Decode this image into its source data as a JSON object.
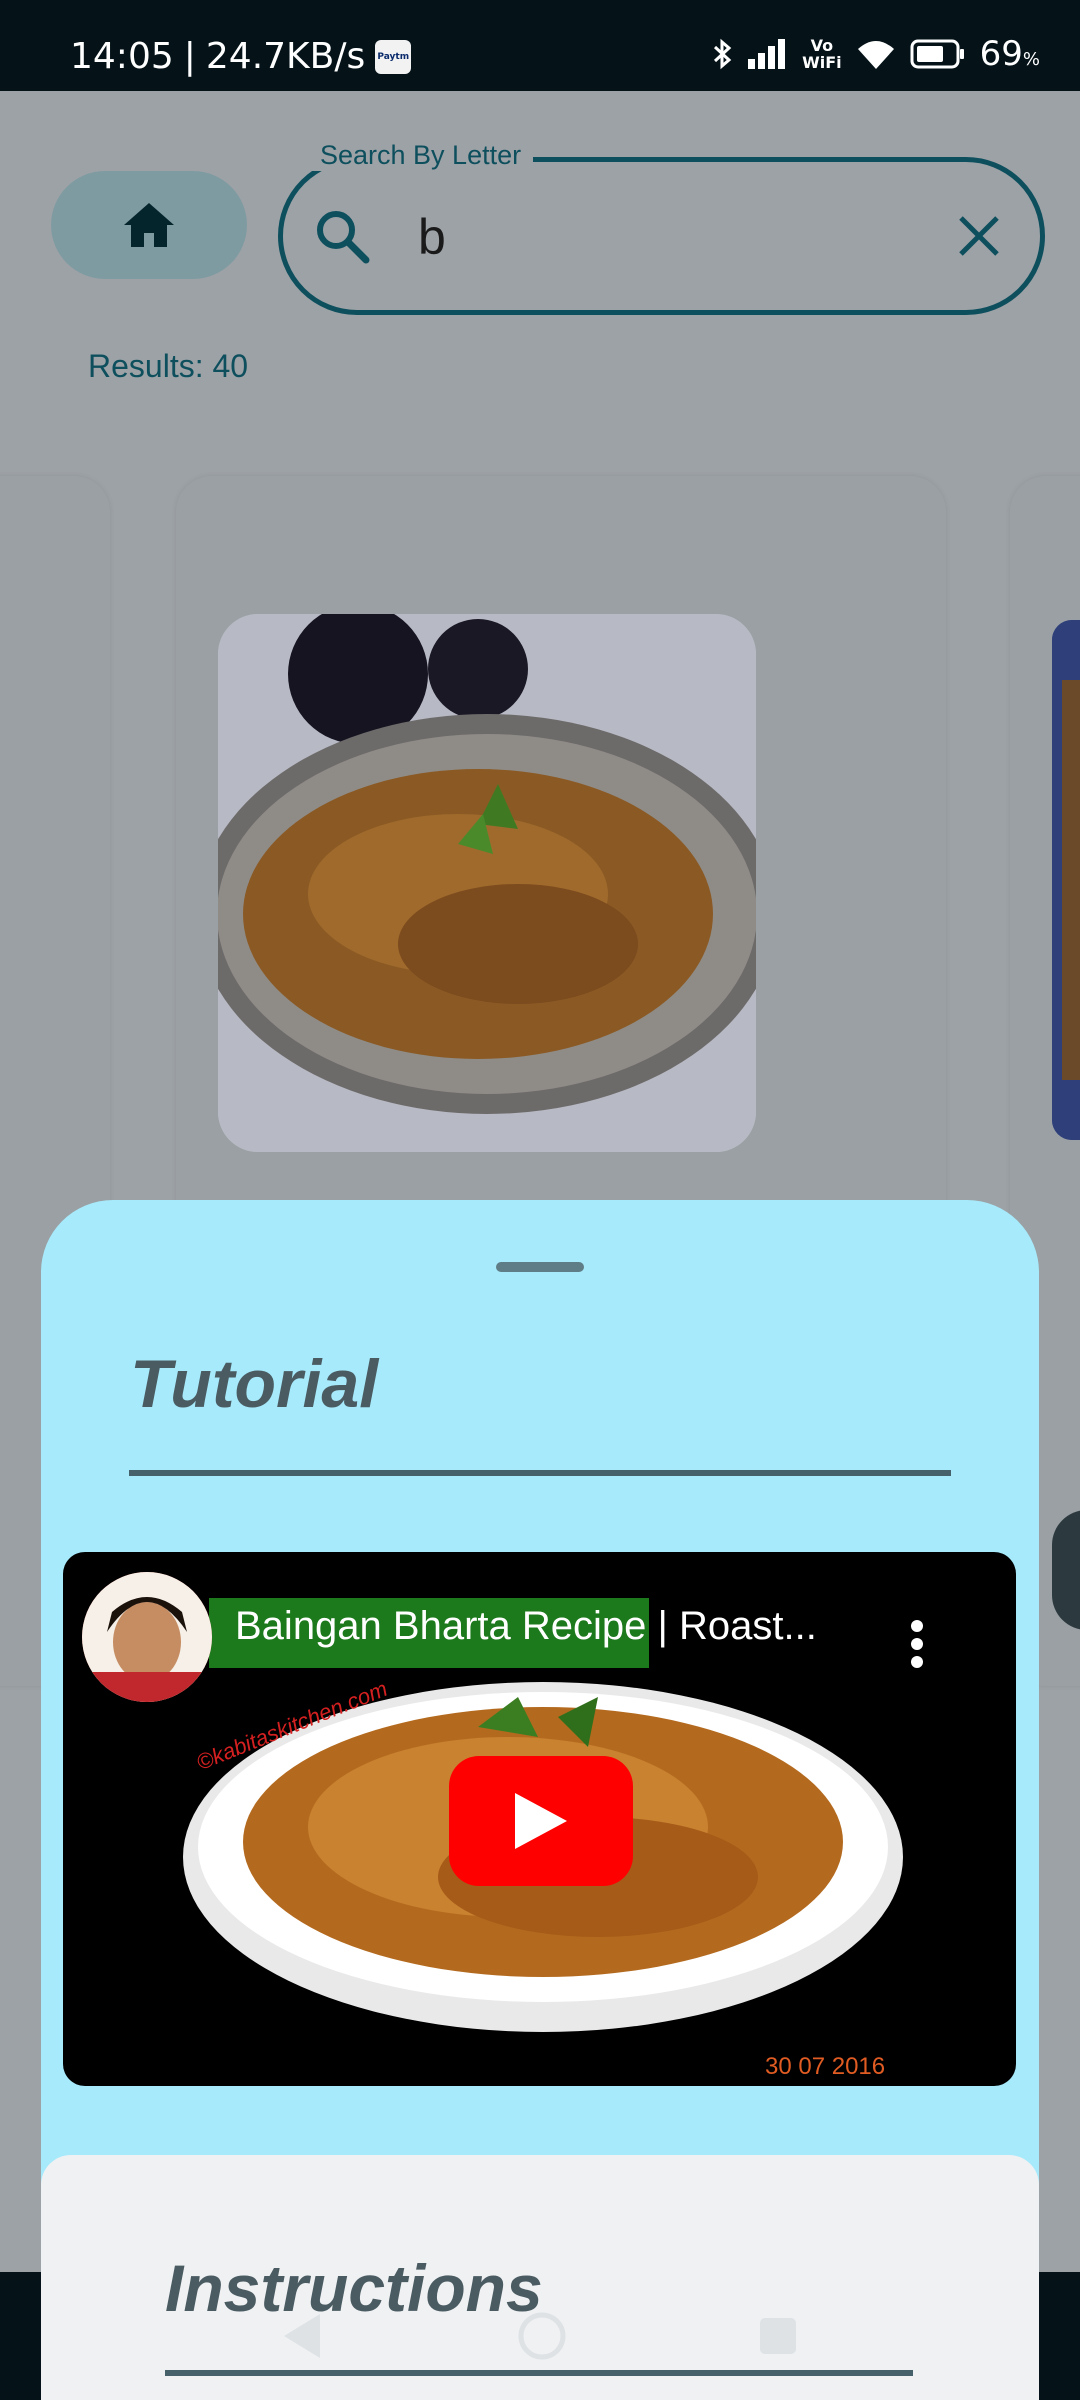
{
  "status_bar": {
    "time": "14:05",
    "separator": "|",
    "speed": "24.7KB/s",
    "paytm": "Paytm",
    "vowifi": [
      "Vo",
      "WiFi"
    ],
    "battery_level": "69",
    "battery_unit": "%"
  },
  "search": {
    "legend": "Search By Letter",
    "value": "b"
  },
  "results_label": "Results: 40",
  "tutorial": {
    "title": "Tutorial"
  },
  "video": {
    "title": "Baingan Bharta Recipe | Roast...",
    "watermark": "©kabitaskitchen.com",
    "date": "30 07 2016"
  },
  "instructions": {
    "title": "Instructions"
  },
  "colors": {
    "sheet_bg": "#a6eafb",
    "accent_teal": "#0e4f5e",
    "youtube_red": "#ff0000",
    "heading_gray": "#4a5b62"
  },
  "icons": [
    "home-icon",
    "search-icon",
    "close-icon",
    "more-vert-icon",
    "youtube-play-icon",
    "bluetooth-icon",
    "signal-icon",
    "wifi-icon",
    "battery-icon",
    "nav-back-icon",
    "nav-home-icon",
    "nav-recents-icon"
  ]
}
